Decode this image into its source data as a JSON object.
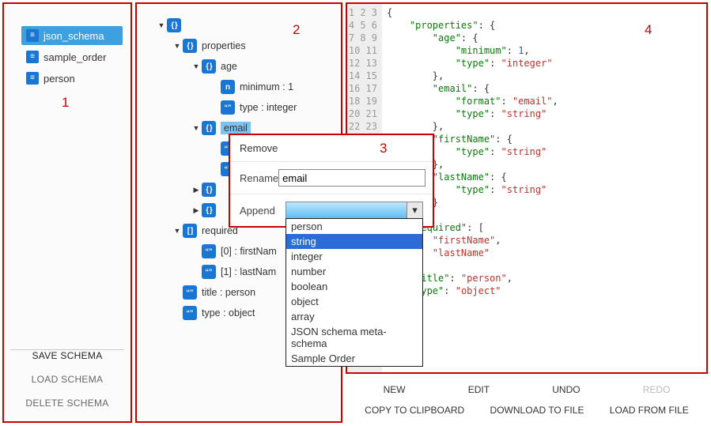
{
  "sidebar": {
    "schemas": [
      {
        "name": "json_schema",
        "selected": true
      },
      {
        "name": "sample_order",
        "selected": false
      },
      {
        "name": "person",
        "selected": false
      }
    ],
    "actions": {
      "save": "SAVE SCHEMA",
      "load": "LOAD SCHEMA",
      "delete": "DELETE SCHEMA"
    }
  },
  "tree": {
    "rows": [
      {
        "depth": 0,
        "caret": "▼",
        "badge": "obj",
        "label": "",
        "sel": false
      },
      {
        "depth": 1,
        "caret": "▼",
        "badge": "obj",
        "label": "properties",
        "sel": false
      },
      {
        "depth": 2,
        "caret": "▼",
        "badge": "obj",
        "label": "age",
        "sel": false
      },
      {
        "depth": 3,
        "caret": "",
        "badge": "num",
        "label": "minimum : 1",
        "sel": false
      },
      {
        "depth": 3,
        "caret": "",
        "badge": "str",
        "label": "type : integer",
        "sel": false
      },
      {
        "depth": 2,
        "caret": "▼",
        "badge": "obj",
        "label": "email",
        "sel": true
      },
      {
        "depth": 3,
        "caret": "",
        "badge": "str",
        "label": "",
        "sel": false
      },
      {
        "depth": 3,
        "caret": "",
        "badge": "str",
        "label": "",
        "sel": false
      },
      {
        "depth": 2,
        "caret": "▶",
        "badge": "obj",
        "label": "",
        "sel": false
      },
      {
        "depth": 2,
        "caret": "▶",
        "badge": "obj",
        "label": "",
        "sel": false
      },
      {
        "depth": 1,
        "caret": "▼",
        "badge": "arr",
        "label": "required",
        "sel": false
      },
      {
        "depth": 2,
        "caret": "",
        "badge": "str",
        "label": "[0] : firstNam",
        "sel": false
      },
      {
        "depth": 2,
        "caret": "",
        "badge": "str",
        "label": "[1] : lastNam",
        "sel": false
      },
      {
        "depth": 1,
        "caret": "",
        "badge": "str",
        "label": "title : person",
        "sel": false
      },
      {
        "depth": 1,
        "caret": "",
        "badge": "str",
        "label": "type : object",
        "sel": false
      }
    ]
  },
  "popup": {
    "remove": "Remove",
    "rename_label": "Rename",
    "rename_value": "email",
    "append_label": "Append",
    "dropdown_options": [
      "person",
      "string",
      "integer",
      "number",
      "boolean",
      "object",
      "array",
      "JSON schema meta-schema",
      "Sample Order"
    ],
    "dropdown_highlight_index": 1
  },
  "code": {
    "line_count": 21,
    "lines_html": [
      "<span class='p'>{</span>",
      "    <span class='k'>\"properties\"</span><span class='p'>: {</span>",
      "        <span class='k'>\"age\"</span><span class='p'>: {</span>",
      "            <span class='k'>\"minimum\"</span><span class='p'>: </span><span class='n'>1</span><span class='p'>,</span>",
      "            <span class='k'>\"type\"</span><span class='p'>: </span><span class='s'>\"integer\"</span>",
      "        <span class='p'>},</span>",
      "        <span class='k'>\"email\"</span><span class='p'>: {</span>",
      "            <span class='k'>\"format\"</span><span class='p'>: </span><span class='s'>\"email\"</span><span class='p'>,</span>",
      "            <span class='k'>\"type\"</span><span class='p'>: </span><span class='s'>\"string\"</span>",
      "        <span class='p'>},</span>",
      "        <span class='k'>\"firstName\"</span><span class='p'>: {</span>",
      "            <span class='k'>\"type\"</span><span class='p'>: </span><span class='s'>\"string\"</span>",
      "        <span class='p'>},</span>",
      "        <span class='k'>\"lastName\"</span><span class='p'>: {</span>",
      "            <span class='k'>\"type\"</span><span class='p'>: </span><span class='s'>\"string\"</span>",
      "        <span class='p'>}</span>",
      "    <span class='p'>},</span>",
      "    <span class='k'>\"required\"</span><span class='p'>: [</span>",
      "        <span class='s'>\"firstName\"</span><span class='p'>,</span>",
      "        <span class='s'>\"lastName\"</span>",
      "    <span class='p'>],</span>",
      "    <span class='k'>\"title\"</span><span class='p'>: </span><span class='s'>\"person\"</span><span class='p'>,</span>",
      "    <span class='k'>\"type\"</span><span class='p'>: </span><span class='s'>\"object\"</span>"
    ]
  },
  "toolbar": {
    "row1": [
      "NEW",
      "EDIT",
      "UNDO",
      "REDO"
    ],
    "row1_disabled_index": 3,
    "row2": [
      "COPY TO CLIPBOARD",
      "DOWNLOAD TO FILE",
      "LOAD FROM FILE"
    ]
  },
  "overlay_labels": {
    "p1": "1",
    "p2": "2",
    "p3": "3",
    "p4": "4"
  }
}
